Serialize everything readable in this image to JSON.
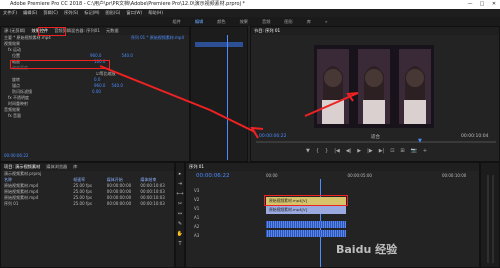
{
  "window": {
    "title": "Adobe Premiere Pro CC 2018 - C:\\用户\\pr\\PR文档\\Adobe\\Premiere Pro\\12.0\\演示视频素材.prproj *",
    "controls": [
      "—",
      "□",
      "✕"
    ]
  },
  "menu": [
    "文件(F)",
    "编辑(E)",
    "剪辑(C)",
    "序列(S)",
    "标记(M)",
    "图形(G)",
    "窗口(W)",
    "帮助(H)"
  ],
  "workspaces": [
    "组件",
    "编辑",
    "颜色",
    "效果",
    "音频",
    "图形",
    "库",
    "»"
  ],
  "left_panel": {
    "tabs": [
      "源:(无剪辑)",
      "效果控件",
      "音频剪辑混合器: 序列01",
      "元数据"
    ],
    "header": "主要 * 原始视频素材.mp4",
    "clip_header": "序列 01 * 原始视频素材.mp4",
    "sections": [
      "视频效果",
      "fx 运动",
      "位置",
      "缩放",
      "缩放宽度",
      "等比缩放",
      "旋转",
      "锚点",
      "防闪烁滤镜",
      "fx 不透明度",
      "时间重映射",
      "音频效果",
      "fx 音量"
    ],
    "values": {
      "position_x": "960.0",
      "position_y": "540.0",
      "scale": "100.0",
      "anchor_x": "960.0",
      "anchor_y": "540.0",
      "rotation": "0.0",
      "flicker": "0.00"
    },
    "timecode": "00:00:06:22"
  },
  "program": {
    "tab": "节目: 序列 01",
    "timecode_left": "00:00:06:22",
    "fit": "适合",
    "timecode_right": "00:00:10:04",
    "controls": [
      "▼",
      "{",
      "}",
      "|◀",
      "◀|",
      "▶",
      "|▶",
      "▶|",
      "⊡",
      "⊞",
      "📷",
      "+"
    ]
  },
  "project": {
    "tabs": [
      "项目: 演示视频素材",
      "媒体浏览器",
      "库"
    ],
    "path": "演示视频素材.prproj",
    "columns": [
      "名称",
      "帧速率",
      "媒体开始",
      "媒体结束"
    ],
    "rows": [
      {
        "name": "原始视频素材.mp4",
        "fps": "25.00 fps",
        "start": "00:00:00:00",
        "end": "00:00:10:03"
      },
      {
        "name": "原始视频素材.mp4",
        "fps": "25.00 fps",
        "start": "00:00:00:00",
        "end": "00:00:10:03"
      },
      {
        "name": "原始视频素材.mp4",
        "fps": "25.00 fps",
        "start": "00:00:00:00",
        "end": "00:00:10:03"
      },
      {
        "name": "序列 01",
        "fps": "25.00 fps",
        "start": "00:00:00:00",
        "end": "00:00:10:03"
      }
    ]
  },
  "timeline": {
    "tab": "序列 01",
    "timecode": "00:00:06:22",
    "ruler": [
      "00:00",
      "00:00:05:00",
      "00:00:10:00"
    ],
    "tracks": [
      "V3",
      "V2",
      "V1",
      "A1",
      "A2",
      "A3"
    ],
    "clip_label": "原始视频素材.mp4[V]"
  },
  "watermark": "Baidu 经验",
  "colors": {
    "accent": "#4c8dff",
    "highlight": "#e22222",
    "clip": "#d7c46a",
    "audio": "#3c6bd8"
  }
}
